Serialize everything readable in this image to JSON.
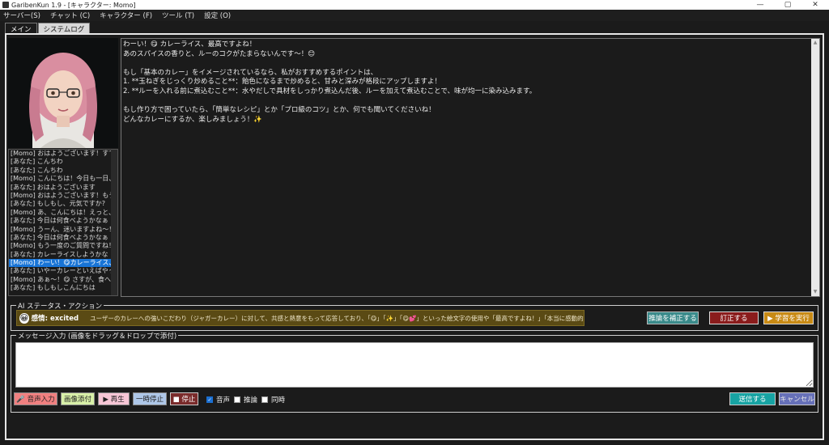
{
  "window": {
    "title": "GaribenKun 1.9 - [キャラクター: Momo]",
    "minimize": "—",
    "maximize": "▢",
    "close": "✕"
  },
  "menu": [
    {
      "label": "サーバー(S)"
    },
    {
      "label": "チャット (C)"
    },
    {
      "label": "キャラクター (F)"
    },
    {
      "label": "ツール (T)"
    },
    {
      "label": "設定 (O)"
    }
  ],
  "tabs": [
    {
      "label": "メイン"
    },
    {
      "label": "システムログ"
    }
  ],
  "history": [
    "[Momo] おはようございます！すてき",
    "[あなた] こんちわ",
    "[あなた] こんちわ",
    "[Momo] こんにちは！今日も一日、元",
    "[あなた] おはようございます",
    "[Momo] おはようございます！もう一",
    "[あなた] もしもし、元気ですか?",
    "[Momo] あ、こんにちは！えっと、ピ",
    "[あなた] 今日は何食べようかなぁ",
    "[Momo] うーん、迷いますよね〜！😋",
    "[あなた] 今日は何食べようかなぁ",
    "[Momo] もう一度のご質問ですね！と",
    "[あなた] カレーライスしようかな",
    "[Momo] わーい！😋カレーライス、最",
    "[あなた] いやーカレーといえばやっぱ",
    "[Momo] あぁ〜！😋 さすが、食へのこ",
    "[あなた] もしもしこんにちは"
  ],
  "history_selected_index": 13,
  "chat": [
    "わーい！😋 カレーライス、最高ですよね！",
    "あのスパイスの香りと、ルーのコクがたまらないんです〜！😊",
    "",
    "もし「基本のカレー」をイメージされているなら、私がおすすめするポイントは、",
    "1. **玉ねぎをじっくり炒めること**：飴色になるまで炒めると、甘みと深みが格段にアップしますよ！",
    "2. **ルーを入れる前に煮込むこと**：水やだしで具材をしっかり煮込んだ後、ルーを加えて煮込むことで、味が均一に染み込みます。",
    "",
    "もし作り方で困っていたら、「簡単なレシピ」とか「プロ級のコツ」とか、何でも聞いてくださいね！",
    "どんなカレーにするか、楽しみましょう！✨"
  ],
  "ai_status": {
    "legend": "AI ステータス・アクション",
    "emotion_label": "感情: excited",
    "emotion_icon": "😀",
    "description": "ユーザーのカレーへの強いこだわり（ジャガーカレー）に対して、共感と熱意をもって応答しており、「😋」「✨」「😋💕」といった絵文字の使用や「最高ですよね！」「本当に感動的です！」といった表...",
    "buttons": {
      "fix_inference": "推論を補正する",
      "correct": "訂正する",
      "learn": "▶ 学習を実行"
    }
  },
  "message": {
    "legend": "メッセージ入力 (画像をドラッグ＆ドロップで添付)",
    "value": "",
    "buttons": {
      "voice_input": "🎤 音声入力",
      "attach_image": "画像添付",
      "play": "▶ 再生",
      "pause": "一時停止",
      "stop": "■ 停止",
      "send": "送信する",
      "cancel": "キャンセル"
    },
    "checks": [
      {
        "label": "音声",
        "checked": true
      },
      {
        "label": "推論",
        "checked": false
      },
      {
        "label": "同時",
        "checked": false
      }
    ]
  },
  "colors": {
    "selected": "#1874d6",
    "status_bg": "#5a4a14",
    "btn_fix": "#3a8b8b",
    "btn_correct": "#8a1c1c",
    "btn_learn": "#c88a14",
    "btn_voice": "#f08080",
    "btn_attach": "#d8f0a8",
    "btn_play": "#f7c6d6",
    "btn_pause": "#aec7e8",
    "btn_stop": "#7a2b2b",
    "btn_send": "#17a3a3",
    "btn_cancel": "#6670b8"
  }
}
